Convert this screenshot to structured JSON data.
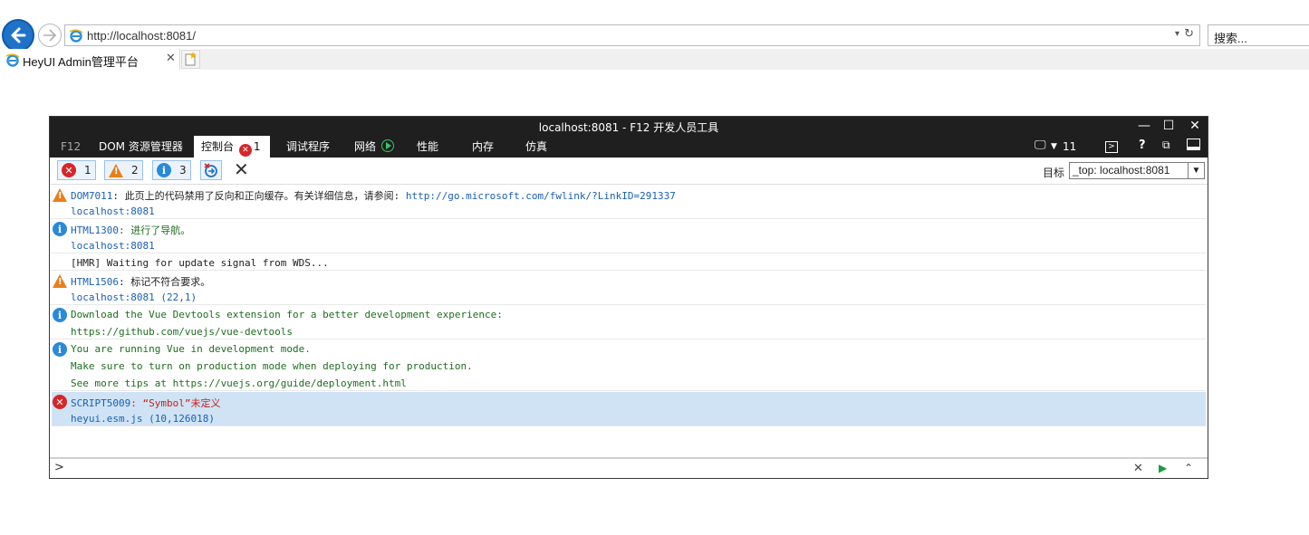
{
  "browser": {
    "address": "http://localhost:8081/",
    "search_placeholder": "搜索...",
    "tab_title": "HeyUI Admin管理平台",
    "accent_color": "#1e73c8"
  },
  "devtools": {
    "title": "localhost:8081 - F12 开发人员工具",
    "tabs": [
      {
        "label": "F12"
      },
      {
        "label": "DOM 资源管理器"
      },
      {
        "label": "控制台"
      },
      {
        "label": "调试程序"
      },
      {
        "label": "网络"
      },
      {
        "label": "性能"
      },
      {
        "label": "内存"
      },
      {
        "label": "仿真"
      }
    ],
    "console_error_badge": "1",
    "emulation_count": "11",
    "filters": {
      "errors": "1",
      "warnings": "2",
      "info": "3"
    },
    "target_label": "目标",
    "target_value": "_top: localhost:8081",
    "entries": [
      {
        "type": "warning",
        "code": "DOM7011",
        "msg": ": 此页上的代码禁用了反向和正向缓存。有关详细信息，请参阅: ",
        "link": "http://go.microsoft.com/fwlink/?LinkID=291337",
        "source": "localhost:8081"
      },
      {
        "type": "info",
        "code": "HTML1300",
        "msg": ": 进行了导航。",
        "source": "localhost:8081"
      },
      {
        "type": "log",
        "msg": "[HMR] Waiting for update signal from WDS..."
      },
      {
        "type": "warning",
        "code": "HTML1506",
        "msg": ": 标记不符合要求。",
        "source": "localhost:8081 (22,1)"
      },
      {
        "type": "info",
        "msg": "Download the Vue Devtools extension for a better development experience:",
        "line2": "https://github.com/vuejs/vue-devtools"
      },
      {
        "type": "info",
        "msg": "You are running Vue in development mode.",
        "line2": "Make sure to turn on production mode when deploying for production.",
        "line3": "See more tips at https://vuejs.org/guide/deployment.html"
      },
      {
        "type": "error",
        "code": "SCRIPT5009",
        "msg": ": “Symbol”未定义",
        "source": "heyui.esm.js (10,126018)"
      }
    ]
  }
}
